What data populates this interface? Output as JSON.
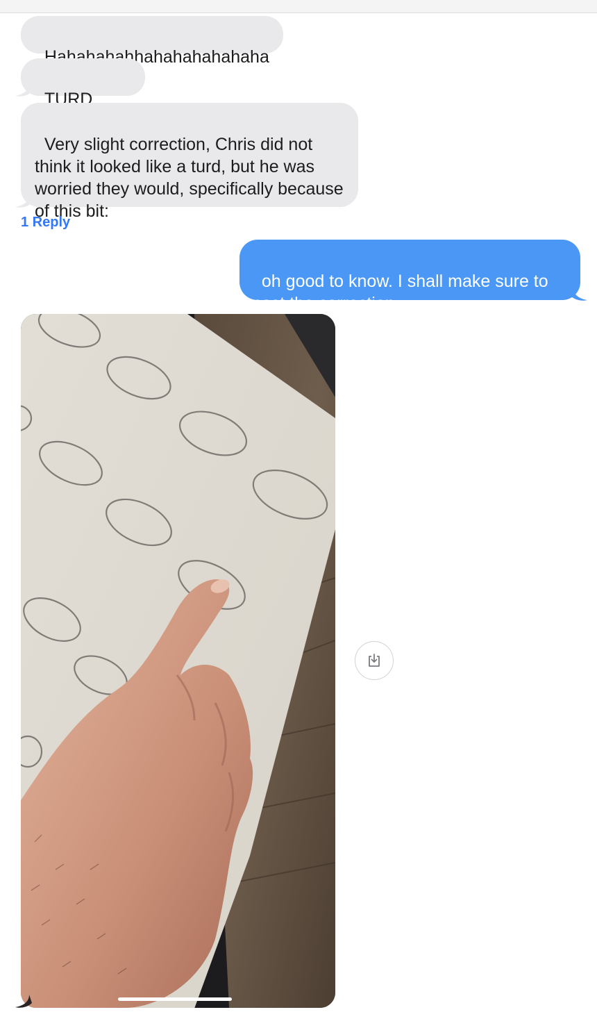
{
  "messages": {
    "m1": {
      "text": "Hahahahahhahahahahahaha",
      "sender": "incoming"
    },
    "m2": {
      "text": "TURD LAKE",
      "sender": "incoming"
    },
    "m3": {
      "text": "Very slight correction, Chris did not think it looked like a turd, but he was worried they would, specifically because of this bit:",
      "sender": "incoming"
    },
    "m4": {
      "text": "oh good to know. I shall make sure to post the correction",
      "sender": "outgoing"
    },
    "m5": {
      "type": "image",
      "sender": "incoming"
    }
  },
  "thread": {
    "reply_label": "1 Reply"
  },
  "icons": {
    "download": "download-icon"
  },
  "colors": {
    "incoming_bubble": "#e9e9eb",
    "outgoing_bubble": "#4a97f5",
    "link": "#3478f6"
  }
}
